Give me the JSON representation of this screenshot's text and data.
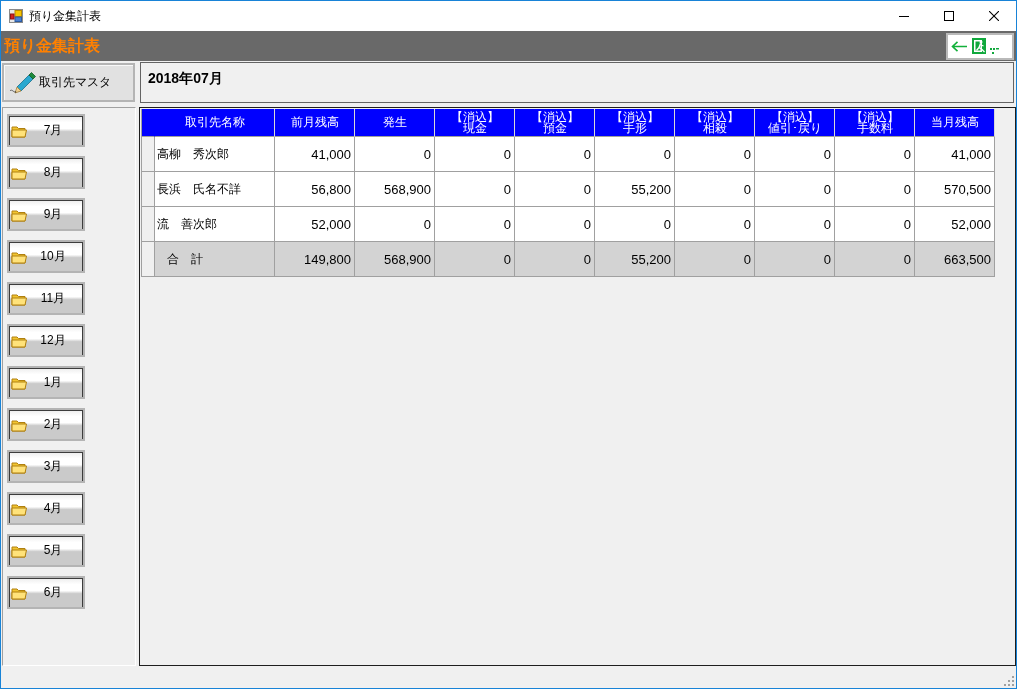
{
  "window": {
    "title": "預り金集計表"
  },
  "header": {
    "title": "預り金集計表"
  },
  "toolbar": {
    "master_button": "取引先マスタ",
    "period": "2018年07月"
  },
  "months": [
    {
      "label": "7月"
    },
    {
      "label": "8月"
    },
    {
      "label": "9月"
    },
    {
      "label": "10月"
    },
    {
      "label": "11月"
    },
    {
      "label": "12月"
    },
    {
      "label": "1月"
    },
    {
      "label": "2月"
    },
    {
      "label": "3月"
    },
    {
      "label": "4月"
    },
    {
      "label": "5月"
    },
    {
      "label": "6月"
    }
  ],
  "table": {
    "columns": [
      {
        "label": "取引先名称"
      },
      {
        "label": "前月残高"
      },
      {
        "label": "発生"
      },
      {
        "prefix": "【消込】",
        "label": "現金"
      },
      {
        "prefix": "【消込】",
        "label": "預金"
      },
      {
        "prefix": "【消込】",
        "label": "手形"
      },
      {
        "prefix": "【消込】",
        "label": "相殺"
      },
      {
        "prefix": "【消込】",
        "label": "値引･戻り"
      },
      {
        "prefix": "【消込】",
        "label": "手数料"
      },
      {
        "label": "当月残高"
      }
    ],
    "rows": [
      {
        "kind": "data",
        "cells": [
          "高柳　秀次郎",
          "41,000",
          "0",
          "0",
          "0",
          "0",
          "0",
          "0",
          "0",
          "41,000"
        ]
      },
      {
        "kind": "data",
        "cells": [
          "長浜　氏名不詳",
          "56,800",
          "568,900",
          "0",
          "0",
          "55,200",
          "0",
          "0",
          "0",
          "570,500"
        ]
      },
      {
        "kind": "data",
        "cells": [
          "流　善次郎",
          "52,000",
          "0",
          "0",
          "0",
          "0",
          "0",
          "0",
          "0",
          "52,000"
        ]
      },
      {
        "kind": "total",
        "cells": [
          "合　計",
          "149,800",
          "568,900",
          "0",
          "0",
          "55,200",
          "0",
          "0",
          "0",
          "663,500"
        ]
      }
    ]
  }
}
